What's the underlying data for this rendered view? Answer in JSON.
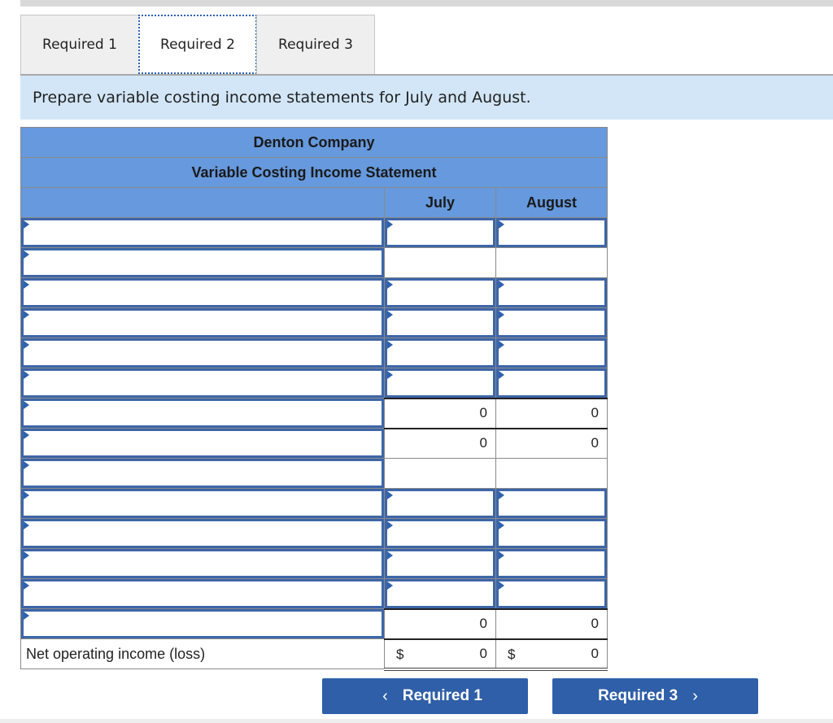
{
  "tabs": [
    {
      "label": "Required 1",
      "active": false
    },
    {
      "label": "Required 2",
      "active": true
    },
    {
      "label": "Required 3",
      "active": false
    }
  ],
  "instruction": "Prepare variable costing income statements for July and August.",
  "statement": {
    "company": "Denton Company",
    "title": "Variable Costing Income Statement",
    "columns": [
      "July",
      "August"
    ],
    "rows": [
      {
        "label": "",
        "label_type": "input",
        "july": {
          "type": "input",
          "value": ""
        },
        "august": {
          "type": "input",
          "value": ""
        }
      },
      {
        "label": "",
        "label_type": "input",
        "july": {
          "type": "blank",
          "value": ""
        },
        "august": {
          "type": "blank",
          "value": ""
        }
      },
      {
        "label": "",
        "label_type": "input",
        "july": {
          "type": "input",
          "value": ""
        },
        "august": {
          "type": "input",
          "value": ""
        }
      },
      {
        "label": "",
        "label_type": "input",
        "july": {
          "type": "input",
          "value": ""
        },
        "august": {
          "type": "input",
          "value": ""
        }
      },
      {
        "label": "",
        "label_type": "input",
        "july": {
          "type": "input",
          "value": ""
        },
        "august": {
          "type": "input",
          "value": ""
        }
      },
      {
        "label": "",
        "label_type": "input",
        "july": {
          "type": "input",
          "value": ""
        },
        "august": {
          "type": "input",
          "value": ""
        }
      },
      {
        "label": "",
        "label_type": "input",
        "july": {
          "type": "computed",
          "value": "0"
        },
        "august": {
          "type": "computed",
          "value": "0"
        }
      },
      {
        "label": "",
        "label_type": "input",
        "july": {
          "type": "computed",
          "value": "0"
        },
        "august": {
          "type": "computed",
          "value": "0"
        }
      },
      {
        "label": "",
        "label_type": "input",
        "july": {
          "type": "blank",
          "value": ""
        },
        "august": {
          "type": "blank",
          "value": ""
        }
      },
      {
        "label": "",
        "label_type": "input",
        "july": {
          "type": "input",
          "value": ""
        },
        "august": {
          "type": "input",
          "value": ""
        }
      },
      {
        "label": "",
        "label_type": "input",
        "july": {
          "type": "input",
          "value": ""
        },
        "august": {
          "type": "input",
          "value": ""
        }
      },
      {
        "label": "",
        "label_type": "input",
        "july": {
          "type": "input",
          "value": ""
        },
        "august": {
          "type": "input",
          "value": ""
        }
      },
      {
        "label": "",
        "label_type": "input",
        "july": {
          "type": "input",
          "value": ""
        },
        "august": {
          "type": "input",
          "value": ""
        }
      },
      {
        "label": "",
        "label_type": "input",
        "july": {
          "type": "computed",
          "value": "0"
        },
        "august": {
          "type": "computed",
          "value": "0"
        }
      }
    ],
    "net": {
      "label": "Net operating income (loss)",
      "currency": "$",
      "july": "0",
      "august": "0"
    }
  },
  "nav": {
    "prev_label": "Required 1",
    "next_label": "Required 3",
    "prev_icon": "‹",
    "next_icon": "›"
  }
}
